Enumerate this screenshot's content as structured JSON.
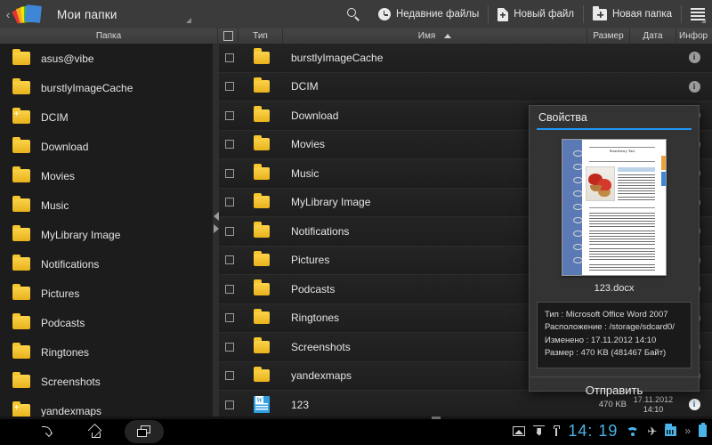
{
  "topbar": {
    "back_chevron": "‹",
    "logo_icon": "fanned-folders-logo",
    "title": "Мои папки",
    "actions": [
      {
        "icon": "search-icon",
        "label": ""
      },
      {
        "icon": "clock-icon",
        "label": "Недавние файлы"
      },
      {
        "icon": "new-file-icon",
        "label": "Новый файл"
      },
      {
        "icon": "new-folder-icon",
        "label": "Новая папка"
      },
      {
        "icon": "menu-icon",
        "label": ""
      }
    ]
  },
  "columns": {
    "folder": "Папка",
    "type": "Тип",
    "name": "Имя",
    "name_sort": "ascending",
    "size": "Размер",
    "date": "Дата",
    "info": "Инфор"
  },
  "sidebar": {
    "items": [
      {
        "label": "asus@vibe",
        "icon": "folder-icon"
      },
      {
        "label": "burstlyImageCache",
        "icon": "folder-icon"
      },
      {
        "label": "DCIM",
        "icon": "folder-plus-icon"
      },
      {
        "label": "Download",
        "icon": "folder-icon"
      },
      {
        "label": "Movies",
        "icon": "folder-icon"
      },
      {
        "label": "Music",
        "icon": "folder-icon"
      },
      {
        "label": "MyLibrary Image",
        "icon": "folder-icon"
      },
      {
        "label": "Notifications",
        "icon": "folder-icon"
      },
      {
        "label": "Pictures",
        "icon": "folder-icon"
      },
      {
        "label": "Podcasts",
        "icon": "folder-icon"
      },
      {
        "label": "Ringtones",
        "icon": "folder-icon"
      },
      {
        "label": "Screenshots",
        "icon": "folder-icon"
      },
      {
        "label": "yandexmaps",
        "icon": "folder-plus-icon"
      }
    ]
  },
  "filelist": {
    "rows": [
      {
        "name": "burstlyImageCache",
        "icon": "folder-icon",
        "size": "",
        "date": "",
        "time": "",
        "info_active": false
      },
      {
        "name": "DCIM",
        "icon": "folder-icon",
        "size": "",
        "date": "",
        "time": "",
        "info_active": false
      },
      {
        "name": "Download",
        "icon": "folder-icon",
        "size": "",
        "date": "",
        "time": "",
        "info_active": false
      },
      {
        "name": "Movies",
        "icon": "folder-icon",
        "size": "",
        "date": "",
        "time": "",
        "info_active": false
      },
      {
        "name": "Music",
        "icon": "folder-icon",
        "size": "",
        "date": "",
        "time": "",
        "info_active": false
      },
      {
        "name": "MyLibrary Image",
        "icon": "folder-icon",
        "size": "",
        "date": "",
        "time": "",
        "info_active": false
      },
      {
        "name": "Notifications",
        "icon": "folder-icon",
        "size": "",
        "date": "",
        "time": "",
        "info_active": false
      },
      {
        "name": "Pictures",
        "icon": "folder-icon",
        "size": "",
        "date": "",
        "time": "",
        "info_active": false
      },
      {
        "name": "Podcasts",
        "icon": "folder-icon",
        "size": "",
        "date": "",
        "time": "",
        "info_active": false
      },
      {
        "name": "Ringtones",
        "icon": "folder-icon",
        "size": "",
        "date": "",
        "time": "",
        "info_active": false
      },
      {
        "name": "Screenshots",
        "icon": "folder-icon",
        "size": "",
        "date": "",
        "time": "",
        "info_active": false
      },
      {
        "name": "yandexmaps",
        "icon": "folder-icon",
        "size": "",
        "date": "",
        "time": "",
        "info_active": false
      },
      {
        "name": "123",
        "icon": "word-document-icon",
        "size": "470 KB",
        "date": "17.11.2012",
        "time": "14:10",
        "info_active": true
      }
    ]
  },
  "dialog": {
    "title": "Свойства",
    "thumbnail": {
      "doc_heading": "Strawberry Tart",
      "photo_alt": "strawberry-tart-photo"
    },
    "filename": "123.docx",
    "props": [
      "Тип : Microsoft Office Word 2007",
      "Расположение : /storage/sdcard0/",
      "Изменено : 17.11.2012 14:10",
      "Размер : 470 KB  (481467 Байт)"
    ],
    "send_label": "Отправить"
  },
  "systembar": {
    "nav": [
      {
        "icon": "back-icon"
      },
      {
        "icon": "home-icon"
      },
      {
        "icon": "recents-icon"
      }
    ],
    "status_icons": [
      "screenshot-icon",
      "download-icon",
      "usb-icon",
      "wifi-icon",
      "airplane-mode-icon",
      "sd-card-icon",
      "more-icon",
      "battery-icon"
    ],
    "clock": "14: 19",
    "plane_glyph": "✈",
    "more_glyph": "»"
  },
  "colors": {
    "accent_blue": "#2196f3",
    "status_blue": "#4ab4e8",
    "folder_yellow": "#f6c62e",
    "word_blue": "#2f9fe0"
  }
}
